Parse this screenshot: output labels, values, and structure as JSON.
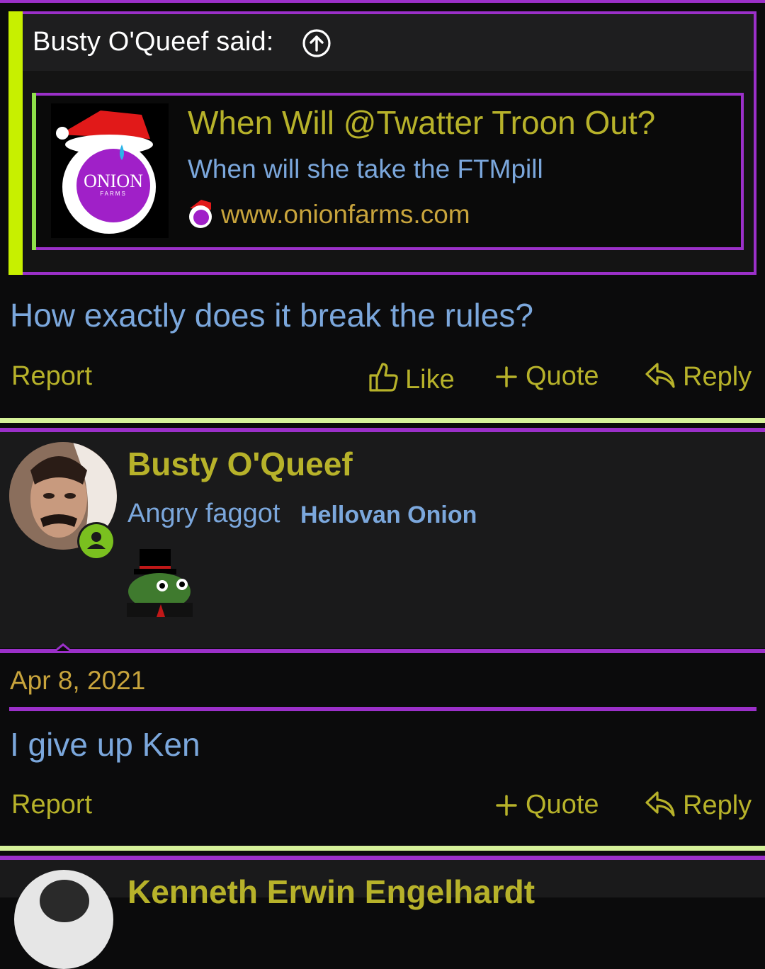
{
  "quote": {
    "author_said": "Busty O'Queef said:",
    "embed": {
      "title": "When Will @Twatter Troon Out?",
      "description": "When will she take the FTMpill",
      "url": "www.onionfarms.com",
      "thumb_text": "ONION",
      "thumb_sub": "FARMS"
    }
  },
  "post1": {
    "text": "How exactly does it break the rules?",
    "actions": {
      "report": "Report",
      "like": "Like",
      "quote": "Quote",
      "reply": "Reply"
    }
  },
  "post2": {
    "username": "Busty O'Queef",
    "user_title": "Angry faggot",
    "user_banner": "Hellovan Onion",
    "date": "Apr 8, 2021",
    "text": "I give up Ken",
    "actions": {
      "report": "Report",
      "quote": "Quote",
      "reply": "Reply"
    }
  },
  "post3": {
    "username": "Kenneth Erwin Engelhardt"
  },
  "colors": {
    "accent_purple": "#9b30c9",
    "link_blue": "#7ba7dc",
    "username_olive": "#b7b22a",
    "date_gold": "#c8a43c",
    "quote_bar": "#c7f000",
    "online_green": "#7ac01f"
  },
  "icons": [
    "arrow-up-circle-icon",
    "thumbs-up-icon",
    "plus-icon",
    "reply-icon",
    "user-online-icon"
  ]
}
